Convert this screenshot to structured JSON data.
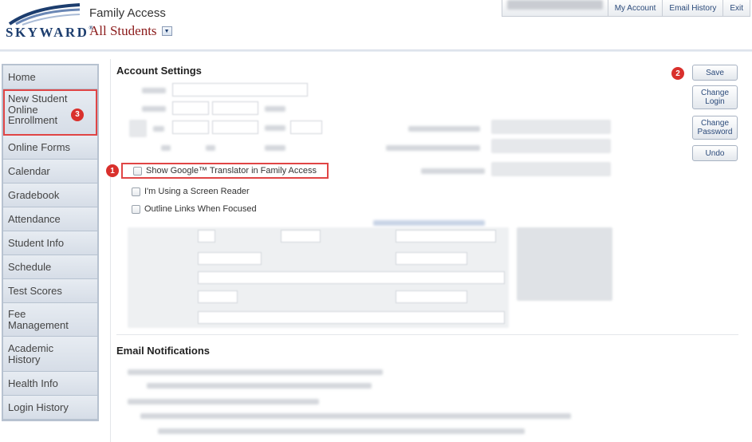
{
  "header": {
    "logo_text": "SKYWARD",
    "logo_tm": "®",
    "app_title": "Family Access",
    "student_selector": "All Students",
    "nav": [
      "My Account",
      "Email History",
      "Exit"
    ]
  },
  "sidebar": {
    "items": [
      {
        "label": "Home"
      },
      {
        "label": "New Student\nOnline\nEnrollment",
        "badge": "3"
      },
      {
        "label": "Online Forms"
      },
      {
        "label": "Calendar"
      },
      {
        "label": "Gradebook"
      },
      {
        "label": "Attendance"
      },
      {
        "label": "Student Info"
      },
      {
        "label": "Schedule"
      },
      {
        "label": "Test Scores"
      },
      {
        "label": "Fee\nManagement"
      },
      {
        "label": "Academic\nHistory"
      },
      {
        "label": "Health Info"
      },
      {
        "label": "Login History"
      }
    ]
  },
  "account_settings": {
    "title": "Account Settings",
    "checkboxes": [
      {
        "label": "Show Google™ Translator in Family Access",
        "badge": "1",
        "checked": false
      },
      {
        "label": "I'm Using a Screen Reader",
        "checked": false
      },
      {
        "label": "Outline Links When Focused",
        "checked": false
      }
    ]
  },
  "email_notifications": {
    "title": "Email Notifications"
  },
  "buttons": {
    "save": "Save",
    "save_badge": "2",
    "change_login": "Change\nLogin",
    "change_password": "Change\nPassword",
    "undo": "Undo"
  },
  "colors": {
    "highlight_red": "#e04545",
    "badge_red": "#d9302c",
    "sidebar_bg": "#b7c2d0",
    "brand_navy": "#1c3d6e",
    "student_red": "#8b1a1a"
  }
}
